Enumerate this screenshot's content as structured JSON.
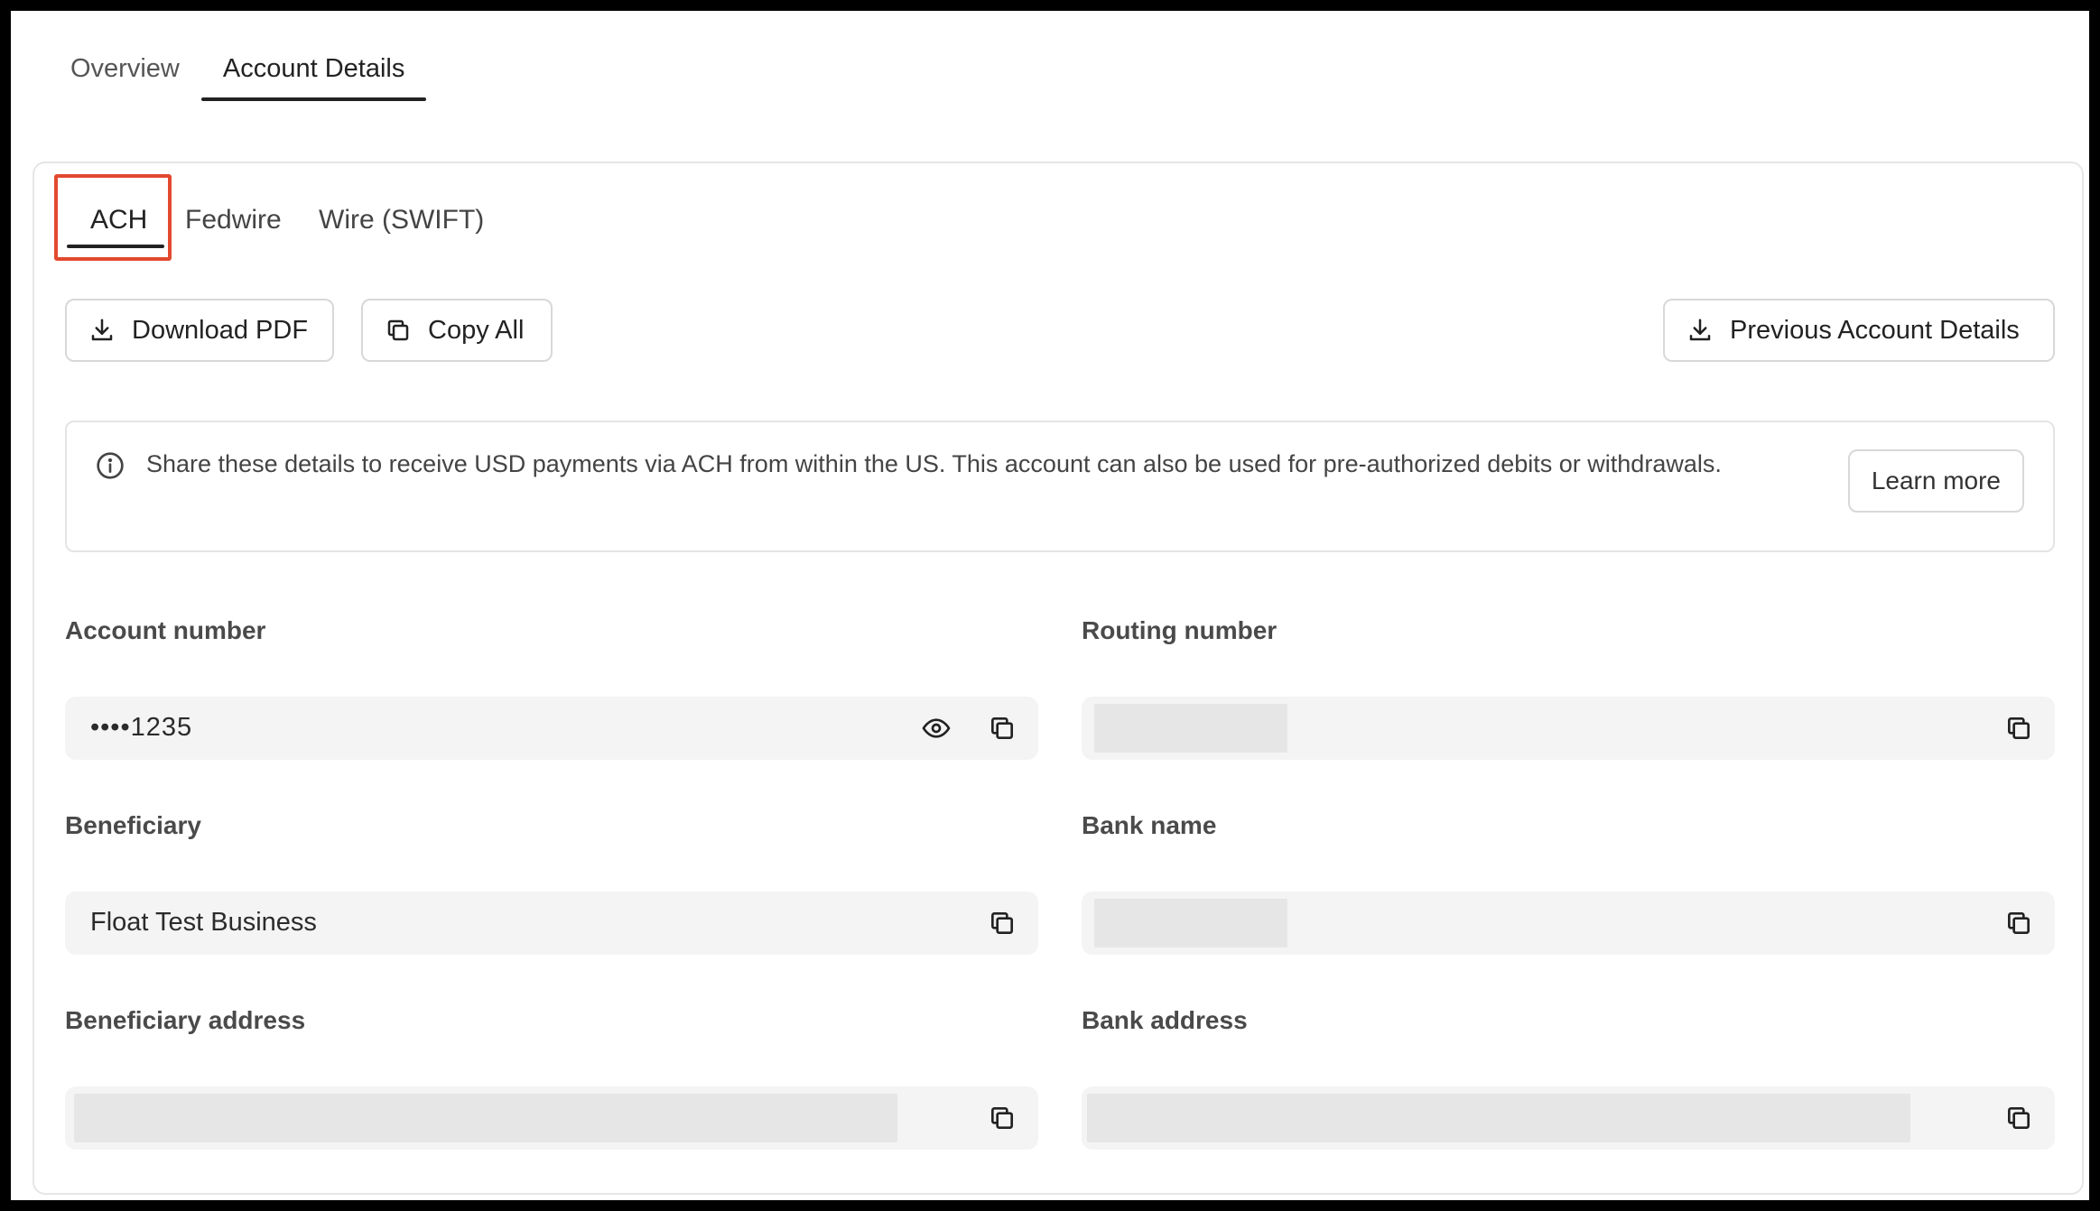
{
  "top_tabs": {
    "overview": "Overview",
    "account_details": "Account Details"
  },
  "sub_tabs": {
    "ach": "ACH",
    "fedwire": "Fedwire",
    "wire": "Wire (SWIFT)"
  },
  "toolbar": {
    "download_pdf": "Download PDF",
    "copy_all": "Copy All",
    "previous_details": "Previous Account Details"
  },
  "info": {
    "text": "Share these details to receive USD payments via ACH from within the US. This account can also be used for pre-authorized debits or withdrawals.",
    "learn_more": "Learn more"
  },
  "fields": {
    "account_number": {
      "label": "Account number",
      "value": "••••1235"
    },
    "routing_number": {
      "label": "Routing number"
    },
    "beneficiary": {
      "label": "Beneficiary",
      "value": "Float Test Business"
    },
    "bank_name": {
      "label": "Bank name"
    },
    "beneficiary_address": {
      "label": "Beneficiary address"
    },
    "bank_address": {
      "label": "Bank address"
    }
  },
  "icons": {
    "download": "download-icon",
    "copy": "copy-icon",
    "info": "info-icon",
    "eye": "eye-icon"
  },
  "colors": {
    "highlight": "#e2492f",
    "field_bg": "#f4f4f4",
    "redaction": "#e6e6e6"
  }
}
